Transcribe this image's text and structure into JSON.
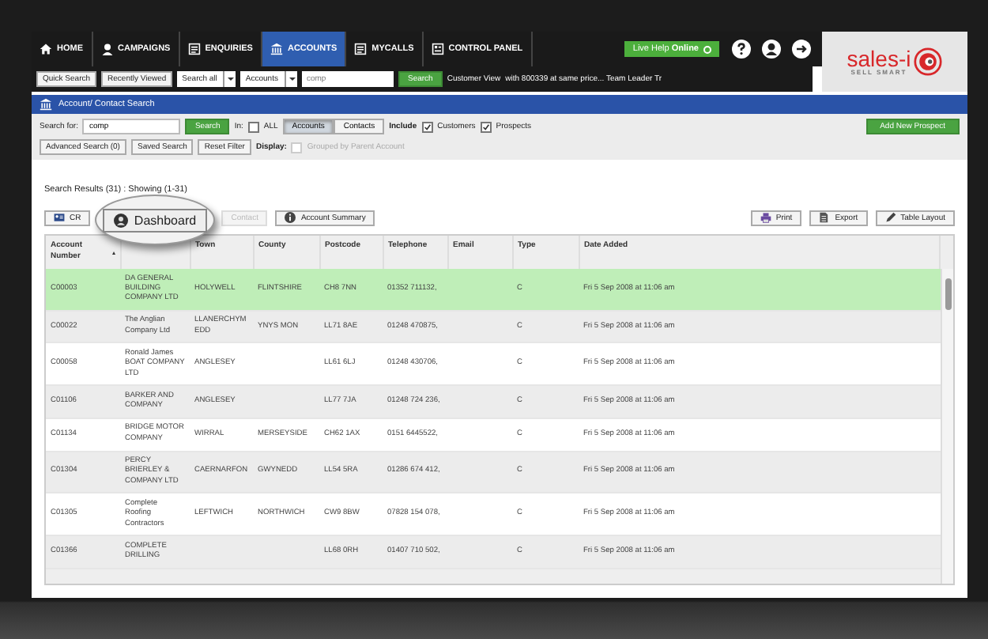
{
  "nav": {
    "items": [
      {
        "label": "HOME",
        "kind": "home",
        "selected": false
      },
      {
        "label": "CAMPAIGNS",
        "kind": "person",
        "selected": false
      },
      {
        "label": "ENQUIRIES",
        "kind": "list",
        "selected": false
      },
      {
        "label": "ACCOUNTS",
        "kind": "bank",
        "selected": true
      },
      {
        "label": "MYCALLS",
        "kind": "list",
        "selected": false
      },
      {
        "label": "CONTROL PANEL",
        "kind": "panel",
        "selected": false
      }
    ],
    "live_help": "Live Help **Online**",
    "logo": {
      "name": "sales-i",
      "tagline": "SELL SMART"
    }
  },
  "quickbar": {
    "buttons": [
      "Quick Search",
      "Recently Viewed"
    ],
    "selects": [
      "Search all",
      "Accounts"
    ],
    "search_value": "comp",
    "search_button": "Search",
    "view_label": "Customer View",
    "info": "with 800339 at same price... Team Leader Tr"
  },
  "section_title": "Account/ Contact Search",
  "search": {
    "label": "Search for:",
    "value": "comp",
    "button": "Search",
    "in_label": "In:",
    "all": {
      "label": "ALL",
      "checked": false
    },
    "scopes": [
      {
        "label": "Accounts",
        "selected": true
      },
      {
        "label": "Contacts",
        "selected": false
      }
    ],
    "include_label": "Include",
    "include": [
      {
        "label": "Customers",
        "checked": true
      },
      {
        "label": "Prospects",
        "checked": true
      }
    ],
    "add_button": "Add New Prospect"
  },
  "filters": {
    "buttons": [
      "Advanced Search (0)",
      "Saved Search",
      "Reset Filter"
    ],
    "display_label": "Display:",
    "grouped": {
      "label": "Grouped by Parent Account",
      "checked": false,
      "disabled": true
    }
  },
  "results_summary": "Search Results (31) : Showing (1-31)",
  "toolbar": {
    "left": [
      {
        "label": "CR",
        "kind": "card",
        "disabled": false
      },
      {
        "label": "Contact",
        "kind": "plain",
        "disabled": true
      },
      {
        "label": "Account Summary",
        "kind": "info",
        "disabled": false
      }
    ],
    "right": [
      {
        "label": "Print",
        "kind": "print"
      },
      {
        "label": "Export",
        "kind": "export"
      },
      {
        "label": "Table Layout",
        "kind": "pencil"
      }
    ],
    "callout": {
      "label": "Dashboard"
    }
  },
  "table": {
    "columns": [
      {
        "label": "Account Number",
        "sorted": true
      },
      {},
      {
        "label": "Town",
        "sorted": false
      },
      {
        "label": "County",
        "sorted": false
      },
      {
        "label": "Postcode",
        "sorted": false
      },
      {
        "label": "Telephone",
        "sorted": false
      },
      {
        "label": "Email",
        "sorted": false
      },
      {
        "label": "Type",
        "sorted": false
      },
      {
        "label": "Date Added",
        "sorted": false
      }
    ],
    "rows": [
      {
        "selected": true,
        "cells": [
          "C00003",
          "DA GENERAL BUILDING COMPANY LTD",
          "HOLYWELL",
          "FLINTSHIRE",
          "CH8 7NN",
          "01352 711132,",
          "",
          "C",
          "Fri 5 Sep 2008 at 11:06 am"
        ]
      },
      {
        "selected": false,
        "cells": [
          "C00022",
          "The Anglian Company Ltd",
          "LLANERCHYMEDD",
          "YNYS MON",
          "LL71 8AE",
          "01248 470875,",
          "",
          "C",
          "Fri 5 Sep 2008 at 11:06 am"
        ]
      },
      {
        "selected": false,
        "cells": [
          "C00058",
          "Ronald James BOAT COMPANY LTD",
          "ANGLESEY",
          "",
          "LL61 6LJ",
          "01248 430706,",
          "",
          "C",
          "Fri 5 Sep 2008 at 11:06 am"
        ]
      },
      {
        "selected": false,
        "cells": [
          "C01106",
          "BARKER AND COMPANY",
          "ANGLESEY",
          "",
          "LL77 7JA",
          "01248 724 236,",
          "",
          "C",
          "Fri 5 Sep 2008 at 11:06 am"
        ]
      },
      {
        "selected": false,
        "cells": [
          "C01134",
          "BRIDGE MOTOR COMPANY",
          "WIRRAL",
          "MERSEYSIDE",
          "CH62 1AX",
          "0151 6445522,",
          "",
          "C",
          "Fri 5 Sep 2008 at 11:06 am"
        ]
      },
      {
        "selected": false,
        "cells": [
          "C01304",
          "PERCY BRIERLEY & COMPANY LTD",
          "CAERNARFON",
          "GWYNEDD",
          "LL54 5RA",
          "01286 674 412,",
          "",
          "C",
          "Fri 5 Sep 2008 at 11:06 am"
        ]
      },
      {
        "selected": false,
        "cells": [
          "C01305",
          "Complete Roofing Contractors",
          "LEFTWICH",
          "NORTHWICH",
          "CW9 8BW",
          "07828 154 078,",
          "",
          "C",
          "Fri 5 Sep 2008 at 11:06 am"
        ]
      },
      {
        "selected": false,
        "cells": [
          "C01366",
          "COMPLETE DRILLING",
          "",
          "",
          "LL68 0RH",
          "01407 710 502,",
          "",
          "C",
          "Fri 5 Sep 2008 at 11:06 am"
        ]
      }
    ]
  }
}
